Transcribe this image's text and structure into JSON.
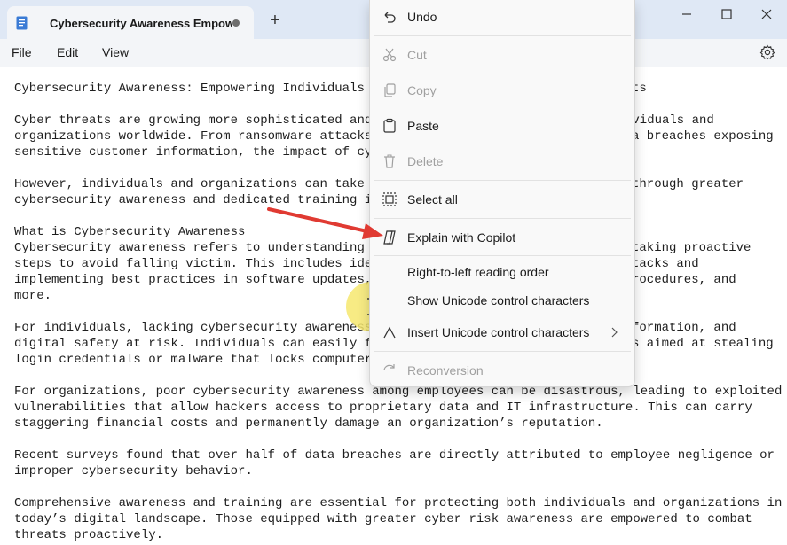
{
  "tab": {
    "title": "Cybersecurity Awareness Empower"
  },
  "menubar": {
    "file": "File",
    "edit": "Edit",
    "view": "View"
  },
  "editor": {
    "lines": [
      "Cybersecurity Awareness: Empowering Individuals an",
      "ts",
      "Cyber threats are growing more sophisticated and f",
      "ividuals and",
      "organizations worldwide. From ransomware attacks t",
      "a breaches exposing",
      "sensitive customer information, the impact of cybe",
      "However, individuals and organizations can take me",
      "through greater",
      "cybersecurity awareness and dedicated training ini",
      "What is Cybersecurity Awareness",
      "Cybersecurity awareness refers to understanding th",
      "taking proactive",
      "steps to avoid falling victim. This includes ident",
      "tacks and",
      "implementing best practices in software updates, s",
      "rocedures, and",
      "more.",
      "For individuals, lacking cybersecurity awareness p",
      "formation, and",
      "digital safety at risk. Individuals can easily fal",
      "s aimed at stealing",
      "login credentials or malware that locks computer s",
      "For organizations, poor cybersecurity awareness among employees can be disastrous, leading to exploited",
      "vulnerabilities that allow hackers access to proprietary data and IT infrastructure. This can carry",
      "staggering financial costs and permanently damage an organization’s reputation.",
      "Recent surveys found that over half of data breaches are directly attributed to employee negligence or",
      "improper cybersecurity behavior.",
      "Comprehensive awareness and training are essential for protecting both individuals and organizations in",
      "today’s digital landscape. Those equipped with greater cyber risk awareness are empowered to combat",
      "threats proactively."
    ]
  },
  "context_menu": {
    "undo": "Undo",
    "cut": "Cut",
    "copy": "Copy",
    "paste": "Paste",
    "delete": "Delete",
    "select_all": "Select all",
    "explain": "Explain with Copilot",
    "rtl": "Right-to-left reading order",
    "show_unicode": "Show Unicode control characters",
    "insert_unicode": "Insert Unicode control characters",
    "reconversion": "Reconversion"
  },
  "colors": {
    "titlebar": "#dfe8f5",
    "annotation_arrow": "#e03a32",
    "cursor_highlight": "#f6e86e"
  },
  "icons": [
    "document-icon",
    "plus-icon",
    "minimize-icon",
    "maximize-icon",
    "close-icon",
    "gear-icon",
    "undo-icon",
    "cut-icon",
    "copy-icon",
    "paste-icon",
    "delete-icon",
    "select-all-icon",
    "copilot-icon",
    "insert-icon",
    "chevron-right-icon",
    "reconversion-icon",
    "text-cursor-icon",
    "annotation-arrow"
  ]
}
